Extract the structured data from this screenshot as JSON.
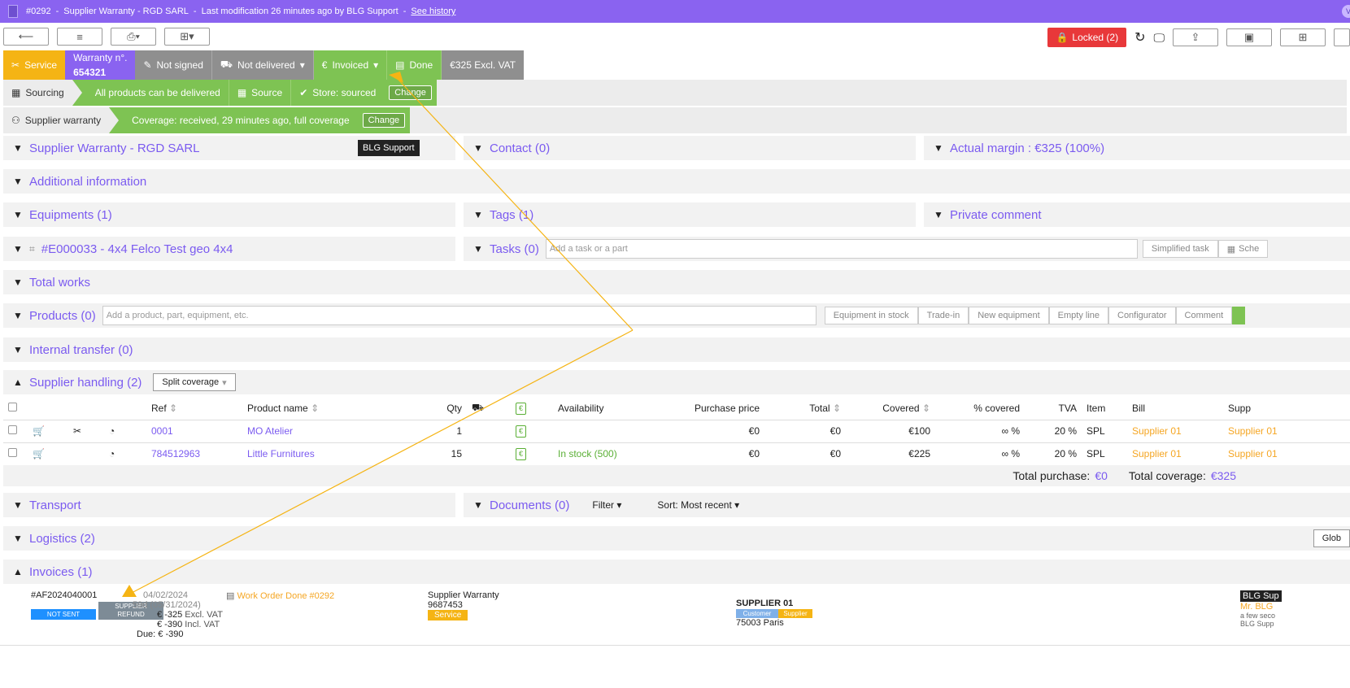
{
  "topbar": {
    "number": "#0292",
    "title": "Supplier Warranty - RGD SARL",
    "modification": "Last modification 26 minutes ago by BLG Support",
    "history_link": "See history",
    "sep": "-",
    "avatar": "V"
  },
  "toolbar": {
    "locked_label": "Locked (2)"
  },
  "status": {
    "service": "Service",
    "warranty_label": "Warranty n°.",
    "warranty_number": "654321",
    "not_signed": "Not signed",
    "not_delivered": "Not delivered",
    "invoiced": "Invoiced",
    "done": "Done",
    "amount": "€325 Excl. VAT"
  },
  "sourcing": {
    "label": "Sourcing",
    "all_products": "All products can be delivered",
    "source": "Source",
    "store": "Store: sourced",
    "change": "Change"
  },
  "supplier_warranty": {
    "label": "Supplier warranty",
    "coverage": "Coverage: received, 29 minutes ago, full coverage",
    "change": "Change"
  },
  "tooltip": "BLG Support",
  "sections": {
    "supplier_warranty_title": "Supplier Warranty - RGD SARL",
    "contact": "Contact (0)",
    "actual_margin": "Actual margin : €325 (100%)",
    "additional_info": "Additional information",
    "equipments": "Equipments (1)",
    "tags": "Tags (1)",
    "private_comment": "Private comment",
    "equipment_item": "#E000033 - 4x4 Felco Test geo 4x4",
    "tasks": "Tasks (0)",
    "tasks_placeholder": "Add a task or a part",
    "simplified_task": "Simplified task",
    "schedule": "Sche",
    "total_works": "Total works",
    "products": "Products (0)",
    "products_placeholder": "Add a product, part, equipment, etc.",
    "product_buttons": [
      "Equipment in stock",
      "Trade-in",
      "New equipment",
      "Empty line",
      "Configurator",
      "Comment"
    ],
    "internal_transfer": "Internal transfer (0)",
    "supplier_handling": "Supplier handling (2)",
    "split_coverage": "Split coverage",
    "transport": "Transport",
    "documents": "Documents (0)",
    "filter": "Filter",
    "sort": "Sort: Most recent",
    "logistics": "Logistics (2)",
    "global": "Glob",
    "invoices": "Invoices (1)"
  },
  "table": {
    "headers": {
      "ref": "Ref",
      "product_name": "Product name",
      "qty": "Qty",
      "availability": "Availability",
      "purchase_price": "Purchase price",
      "total": "Total",
      "covered": "Covered",
      "pct_covered": "% covered",
      "tva": "TVA",
      "item": "Item",
      "bill": "Bill",
      "supp": "Supp"
    },
    "rows": [
      {
        "ref": "0001",
        "name": "MO Atelier",
        "qty": "1",
        "availability": "",
        "purchase": "€0",
        "total": "€0",
        "covered": "€100",
        "pct": "∞ %",
        "tva": "20 %",
        "item": "SPL",
        "bill": "Supplier 01",
        "supp": "Supplier 01"
      },
      {
        "ref": "784512963",
        "name": "Little Furnitures",
        "qty": "15",
        "availability": "In stock (500)",
        "purchase": "€0",
        "total": "€0",
        "covered": "€225",
        "pct": "∞ %",
        "tva": "20 %",
        "item": "SPL",
        "bill": "Supplier 01",
        "supp": "Supplier 01"
      }
    ],
    "total_purchase_label": "Total purchase:",
    "total_purchase_value": "€0",
    "total_coverage_label": "Total coverage:",
    "total_coverage_value": "€325"
  },
  "invoice": {
    "number": "#AF2024040001",
    "not_sent": "NOT SENT",
    "refund_line1": "SUPPLIER",
    "refund_line2": "REFUND",
    "date": "04/02/2024",
    "due_info": "59d (05/31/2024)",
    "excl_amount": "€ -325",
    "excl_label": "Excl. VAT",
    "incl_amount": "€ -390",
    "incl_label": "Incl. VAT",
    "due": "Due: € -390",
    "work_order": "Work Order Done #0292",
    "warranty_title": "Supplier Warranty",
    "warranty_code": "9687453",
    "service_badge": "Service",
    "supplier": "SUPPLIER 01",
    "customer_badge": "Customer",
    "supplier_badge": "Supplier",
    "city": "75003 Paris",
    "user_badge": "BLG Sup",
    "user_name": "Mr. BLG",
    "time_ago": "a few seco",
    "user_sub": "BLG Supp"
  },
  "colors": {
    "purple": "#8a63f0",
    "green": "#7ec353",
    "orange": "#f5b414",
    "red": "#e8383a",
    "link": "#7b5bf0"
  }
}
